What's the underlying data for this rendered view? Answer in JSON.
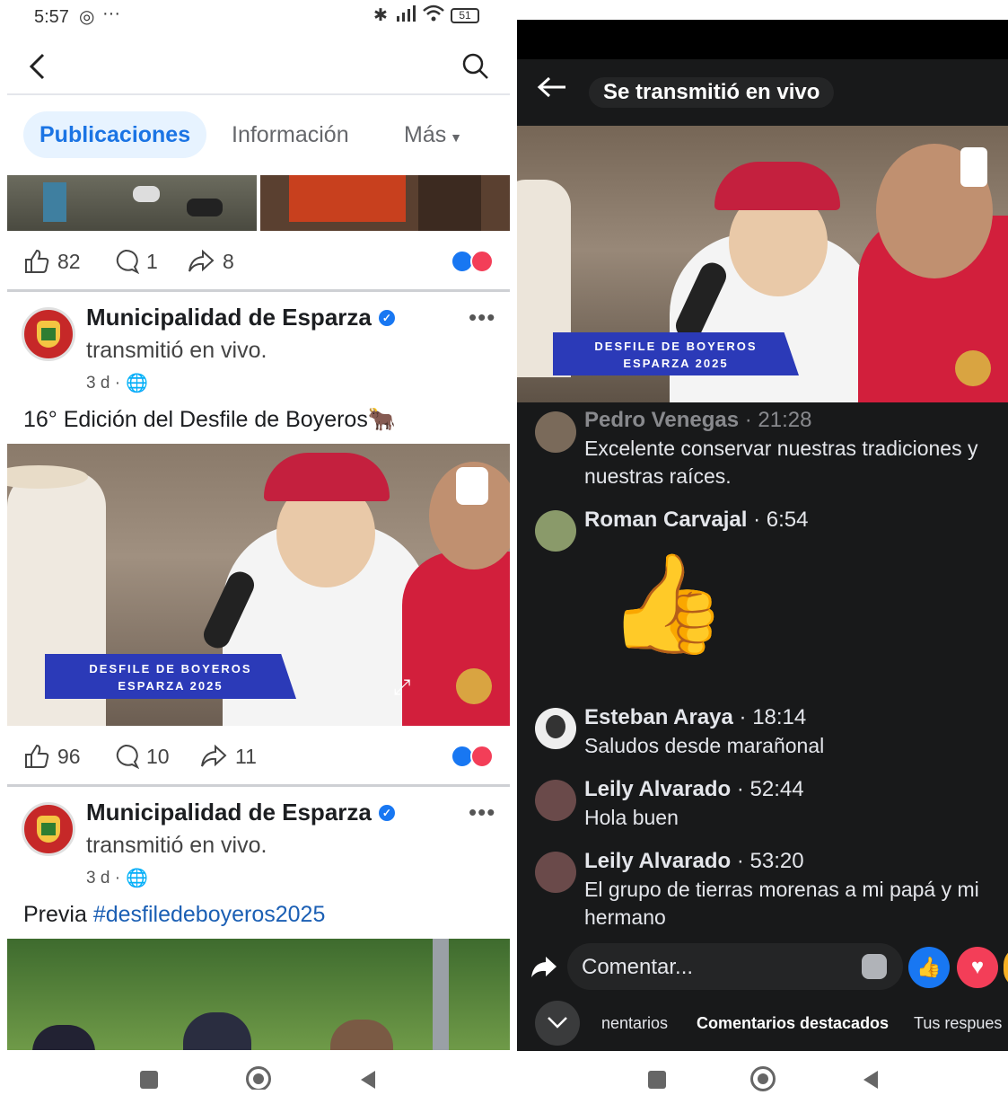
{
  "status_bar": {
    "time": "5:57",
    "battery": "51"
  },
  "left": {
    "tabs": [
      {
        "label": "Publicaciones",
        "active": true
      },
      {
        "label": "Información",
        "active": false
      },
      {
        "label": "Más",
        "active": false
      }
    ],
    "post1_stats": {
      "likes": "82",
      "comments": "1",
      "shares": "8"
    },
    "post2": {
      "page_name": "Municipalidad de Esparza",
      "action": "transmitió en vivo.",
      "time": "3 d ·",
      "caption": "16° Edición del Desfile de Boyeros🐂",
      "banner_line1": "DESFILE DE BOYEROS",
      "banner_line2": "ESPARZA 2025",
      "likes": "96",
      "comments": "10",
      "shares": "11"
    },
    "post3": {
      "page_name": "Municipalidad de Esparza",
      "action": "transmitió en vivo.",
      "time": "3 d ·",
      "caption_prefix": "Previa ",
      "caption_hashtag": "#desfiledeboyeros2025"
    }
  },
  "right": {
    "header_title": "Se transmitió en vivo",
    "banner_line1": "DESFILE DE BOYEROS",
    "banner_line2": "ESPARZA 2025",
    "comments": [
      {
        "name": "Pedro Venegas",
        "time": "21:28",
        "text": "Excelente conservar nuestras tradiciones y nuestras raíces."
      },
      {
        "name": "Roman Carvajal",
        "time": "6:54",
        "text": "👍"
      },
      {
        "name": "Esteban Araya",
        "time": "18:14",
        "text": "Saludos desde marañonal"
      },
      {
        "name": "Leily Alvarado",
        "time": "52:44",
        "text": "Hola buen"
      },
      {
        "name": "Leily Alvarado",
        "time": "53:20",
        "text": "El grupo de tierras morenas a mi papá y mi hermano"
      }
    ],
    "comment_placeholder": "Comentar...",
    "filter_tabs": [
      "nentarios",
      "Comentarios destacados",
      "Tus respues"
    ]
  },
  "colors": {
    "facebook_blue": "#1877f2",
    "love_red": "#f33e58",
    "active_tab_bg": "#e7f3ff",
    "dark_bg": "#18191a"
  }
}
